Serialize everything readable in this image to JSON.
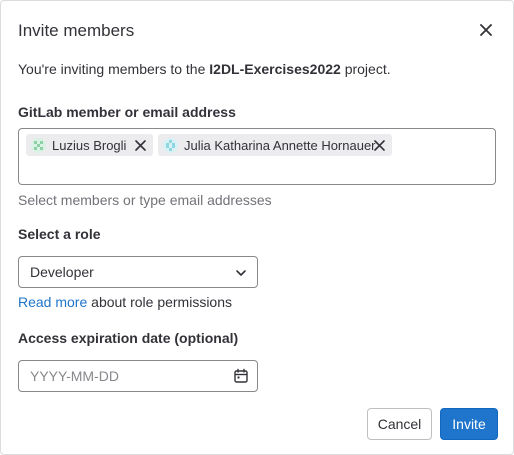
{
  "modal": {
    "title": "Invite members",
    "intro_prefix": "You're inviting members to the ",
    "project_name": "I2DL-Exercises2022",
    "intro_suffix": " project."
  },
  "members_field": {
    "label": "GitLab member or email address",
    "tokens": [
      {
        "name": "Luzius Brogli",
        "avatar_icon": "identicon-green-icon",
        "avatar_color": "#8fd0a8"
      },
      {
        "name": "Julia Katharina Annette Hornauer",
        "avatar_icon": "identicon-cyan-icon",
        "avatar_color": "#8fd6e0"
      }
    ],
    "helper": "Select members or type email addresses"
  },
  "role": {
    "label": "Select a role",
    "selected": "Developer",
    "read_more_link": "Read more",
    "read_more_suffix": " about role permissions"
  },
  "expiration": {
    "label": "Access expiration date (optional)",
    "placeholder": "YYYY-MM-DD"
  },
  "footer": {
    "cancel_label": "Cancel",
    "invite_label": "Invite"
  },
  "colors": {
    "primary": "#1f75cb",
    "border": "#89888d",
    "muted_text": "#737278"
  }
}
